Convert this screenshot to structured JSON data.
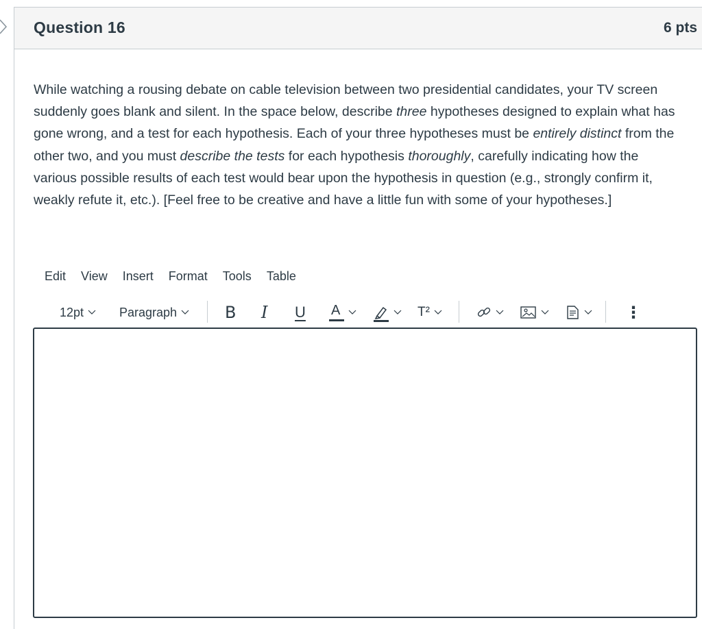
{
  "question": {
    "title": "Question 16",
    "points": "6 pts",
    "paragraph": [
      {
        "text": "While watching a rousing debate on cable television between two presidential candidates, your TV screen suddenly goes blank and silent.  In the space below, describe ",
        "italic": false
      },
      {
        "text": "three",
        "italic": true
      },
      {
        "text": " hypotheses designed to explain what has gone wrong, and a test for each hypothesis.  Each of your three hypotheses must be ",
        "italic": false
      },
      {
        "text": "entirely distinct",
        "italic": true
      },
      {
        "text": " from the other two, and you must ",
        "italic": false
      },
      {
        "text": "describe the tests",
        "italic": true
      },
      {
        "text": " for each hypothesis ",
        "italic": false
      },
      {
        "text": "thoroughly",
        "italic": true
      },
      {
        "text": ", carefully indicating how the various possible results of each test would bear upon the hypothesis in question (e.g., strongly confirm it, weakly refute it, etc.).  [Feel free to be creative and have a little fun with some of your hypotheses.]",
        "italic": false
      }
    ]
  },
  "editor": {
    "menu": [
      "Edit",
      "View",
      "Insert",
      "Format",
      "Tools",
      "Table"
    ],
    "font_size": "12pt",
    "block_format": "Paragraph",
    "bold_glyph": "B",
    "italic_glyph": "I",
    "underline_glyph": "U",
    "text_color_glyph": "A",
    "superscript_glyph": "T²",
    "more_glyph": "⋮",
    "content": ""
  },
  "icons": {
    "left": "chevron-right-icon",
    "highlight": "highlighter-icon",
    "link": "link-icon",
    "image": "image-icon",
    "document": "document-icon",
    "more": "more-vertical-icon"
  },
  "colors": {
    "text": "#2d3b45",
    "header_bg": "#f5f5f5",
    "border": "#c7cdd1"
  }
}
